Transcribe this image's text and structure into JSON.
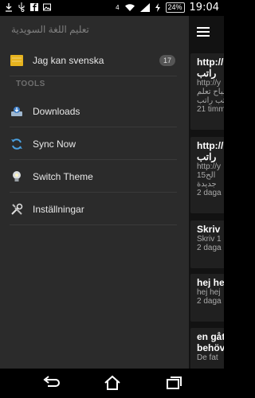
{
  "status_bar": {
    "network": "4",
    "battery": "24%",
    "time": "19:04"
  },
  "drawer": {
    "header": "تعليم اللغة السويدية",
    "main_item": {
      "label": "Jag kan svenska",
      "badge": "17"
    },
    "section_title": "TOOLS",
    "tools": [
      {
        "label": "Downloads"
      },
      {
        "label": "Sync Now"
      },
      {
        "label": "Switch Theme"
      },
      {
        "label": "Inställningar"
      }
    ]
  },
  "feed": [
    {
      "title": "http://",
      "line2": "راتب",
      "sub": "http://y",
      "sub2": "صباح تعلم",
      "sub3": "رتب راتب",
      "time": "21 timm"
    },
    {
      "title": "http://",
      "line2": "راتب",
      "sub": "http://y",
      "sub2": "الح15",
      "sub3": "جديدة",
      "time": "2 daga"
    },
    {
      "title": "Skriv",
      "sub": "Skriv 1",
      "time": "2 daga"
    },
    {
      "title": "hej he",
      "sub": "hej hej",
      "time": "2 daga"
    },
    {
      "title": "en gåt",
      "line2": "behöv",
      "sub": "De fat"
    }
  ],
  "colors": {
    "drawer_bg": "#2b2b2b",
    "content_bg": "#121212",
    "card_bg": "#202020"
  }
}
